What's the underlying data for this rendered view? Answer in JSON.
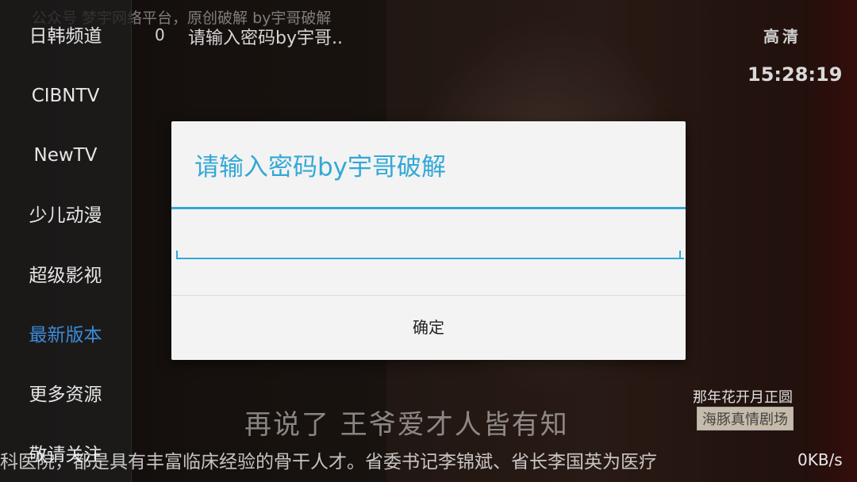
{
  "top_ticker": "公众号 梦宇网络平台，原创破解 by宇哥破解",
  "sidebar": {
    "items": [
      {
        "label": "日韩频道",
        "active": false
      },
      {
        "label": "CIBNTV",
        "active": false
      },
      {
        "label": "NewTV",
        "active": false
      },
      {
        "label": "少儿动漫",
        "active": false
      },
      {
        "label": "超级影视",
        "active": false
      },
      {
        "label": "最新版本",
        "active": true
      },
      {
        "label": "更多资源",
        "active": false
      },
      {
        "label": "敬请关注",
        "active": false
      }
    ]
  },
  "channel_list": {
    "number": "0",
    "name": "请输入密码by宇哥.."
  },
  "status": {
    "quality": "高清",
    "time": "15:28:19"
  },
  "video": {
    "show_title": "那年花开月正圆",
    "channel_logo": "海豚真情剧场",
    "subtitle": "再说了 王爷爱才人皆有知",
    "news_ticker": "科医院，都是具有丰富临床经验的骨干人才。省委书记李锦斌、省长李国英为医疗",
    "speed": "0KB/s"
  },
  "dialog": {
    "title": "请输入密码by宇哥破解",
    "password_value": "",
    "ok_label": "确定"
  },
  "colors": {
    "accent": "#33a8d6",
    "active_menu": "#3d8bd9"
  }
}
